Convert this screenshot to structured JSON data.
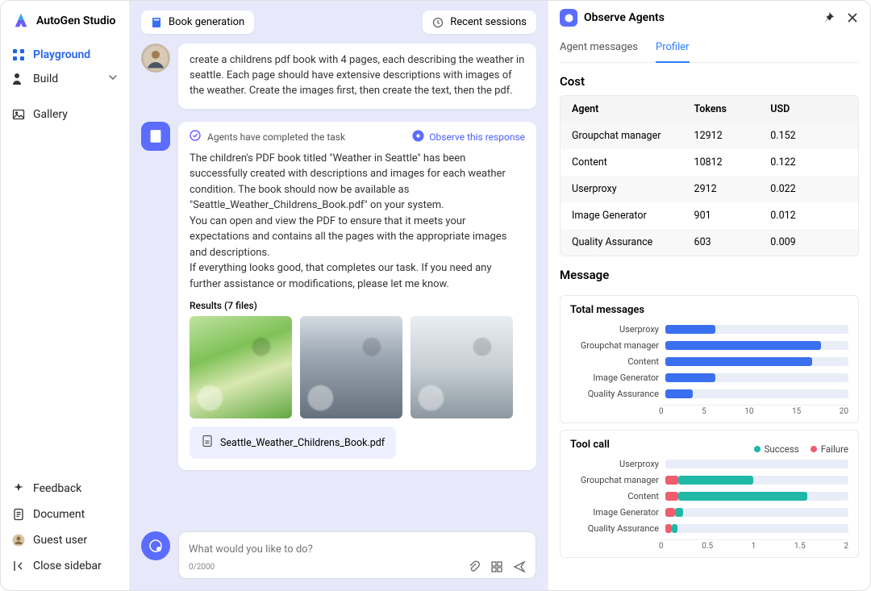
{
  "brand": {
    "name": "AutoGen Studio"
  },
  "sidebar": {
    "nav": [
      {
        "label": "Playground",
        "active": true
      },
      {
        "label": "Build",
        "chevron": true
      },
      {
        "label": "Gallery"
      }
    ],
    "bottom": [
      {
        "label": "Feedback"
      },
      {
        "label": "Document"
      },
      {
        "label": "Guest user"
      },
      {
        "label": "Close sidebar"
      }
    ]
  },
  "chat": {
    "session_chip": "Book generation",
    "recent_chip": "Recent sessions",
    "user_message": "create a childrens pdf book with 4 pages, each describing the weather in seattle. Each page should have extensive descriptions with images of the weather. Create the images first, then create the text, then the pdf.",
    "task_status": "Agents have completed the task",
    "observe_link": "Observe this response",
    "agent_response": "The children's PDF book titled \"Weather in Seattle\" has been successfully created with descriptions and images for each weather condition. The book should now be available as \"Seattle_Weather_Childrens_Book.pdf\" on your system.\nYou can open and view the PDF to ensure that it meets your expectations and contains all the pages with the appropriate images and descriptions.\nIf everything looks good, that completes our task. If you need any further assistance or modifications, please let me know.",
    "results_label": "Results (7 files)",
    "pdf_name": "Seattle_Weather_Childrens_Book.pdf",
    "composer": {
      "placeholder": "What would you like to do?",
      "count": "0/2000"
    }
  },
  "observe": {
    "title": "Observe Agents",
    "tabs": {
      "messages": "Agent messages",
      "profiler": "Profiler"
    },
    "cost": {
      "heading": "Cost",
      "col_agent": "Agent",
      "col_tokens": "Tokens",
      "col_usd": "USD",
      "rows": [
        {
          "agent": "Groupchat manager",
          "tokens": "12912",
          "usd": "0.152"
        },
        {
          "agent": "Content",
          "tokens": "10812",
          "usd": "0.122"
        },
        {
          "agent": "Userproxy",
          "tokens": "2912",
          "usd": "0.022"
        },
        {
          "agent": "Image Generator",
          "tokens": "901",
          "usd": "0.012"
        },
        {
          "agent": "Quality Assurance",
          "tokens": "603",
          "usd": "0.009"
        }
      ]
    },
    "message_heading": "Message",
    "total_messages": {
      "title": "Total messages",
      "legend_success": "Success",
      "legend_failure": "Failure"
    },
    "tool_call": {
      "title": "Tool call"
    }
  },
  "chart_data": [
    {
      "type": "bar",
      "title": "Total messages",
      "orientation": "horizontal",
      "xlabel": "",
      "ylabel": "",
      "xlim": [
        0,
        20
      ],
      "xticks": [
        0,
        5,
        10,
        15,
        20
      ],
      "categories": [
        "Userproxy",
        "Groupchat manager",
        "Content",
        "Image Generator",
        "Quality Assurance"
      ],
      "values": [
        5.5,
        17,
        16,
        5.5,
        3
      ]
    },
    {
      "type": "bar",
      "title": "Tool call",
      "orientation": "horizontal",
      "stacked": true,
      "xlabel": "",
      "ylabel": "",
      "xlim": [
        0,
        2
      ],
      "xticks": [
        0,
        0.5,
        1,
        1.5,
        2
      ],
      "categories": [
        "Userproxy",
        "Groupchat manager",
        "Content",
        "Image Generator",
        "Quality Assurance"
      ],
      "series": [
        {
          "name": "Failure",
          "color": "#f05d6e",
          "values": [
            0,
            0.14,
            0.14,
            0.11,
            0.07
          ]
        },
        {
          "name": "Success",
          "color": "#1fb8a7",
          "values": [
            0,
            0.82,
            1.41,
            0.08,
            0.06
          ]
        }
      ]
    }
  ]
}
